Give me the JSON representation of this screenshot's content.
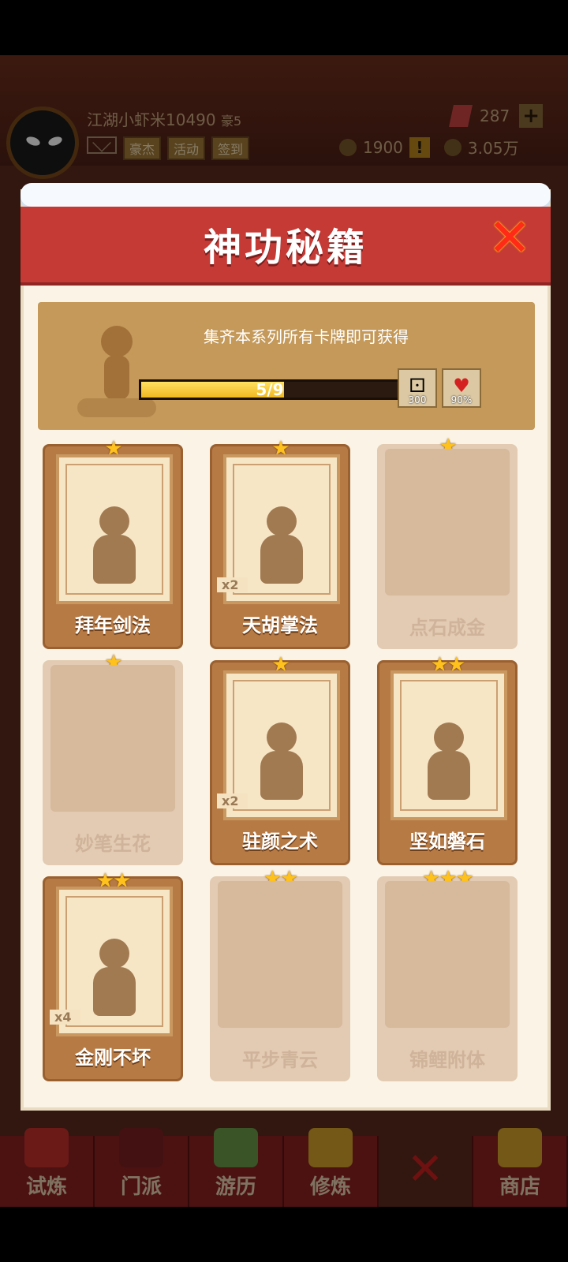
{
  "player": {
    "name": "江湖小虾米10490",
    "rank": "豪5",
    "buttons": [
      "豪杰",
      "活动",
      "签到"
    ]
  },
  "resources": {
    "gems": "287",
    "tokens": "1900",
    "coins": "3.05万"
  },
  "dialog": {
    "title": "神功秘籍",
    "subtitle": "集齐本系列所有卡牌即可获得",
    "progress_text": "5/9",
    "progress": 0.556,
    "rewards": [
      {
        "icon": "dice-icon",
        "value": "300"
      },
      {
        "icon": "heart-icon",
        "value": "90%"
      }
    ]
  },
  "cards": [
    {
      "name": "拜年剑法",
      "stars": "★",
      "unlocked": true,
      "count": ""
    },
    {
      "name": "天胡掌法",
      "stars": "★",
      "unlocked": true,
      "count": "x2"
    },
    {
      "name": "点石成金",
      "stars": "★",
      "unlocked": false,
      "count": ""
    },
    {
      "name": "妙笔生花",
      "stars": "★",
      "unlocked": false,
      "count": ""
    },
    {
      "name": "驻颜之术",
      "stars": "★",
      "unlocked": true,
      "count": "x2"
    },
    {
      "name": "坚如磐石",
      "stars": "★★",
      "unlocked": true,
      "count": ""
    },
    {
      "name": "金刚不坏",
      "stars": "★★",
      "unlocked": true,
      "count": "x4"
    },
    {
      "name": "平步青云",
      "stars": "★★",
      "unlocked": false,
      "count": ""
    },
    {
      "name": "锦鲤附体",
      "stars": "★★★",
      "unlocked": false,
      "count": ""
    }
  ],
  "nav": [
    "试炼",
    "门派",
    "游历",
    "修炼",
    "",
    "商店"
  ]
}
